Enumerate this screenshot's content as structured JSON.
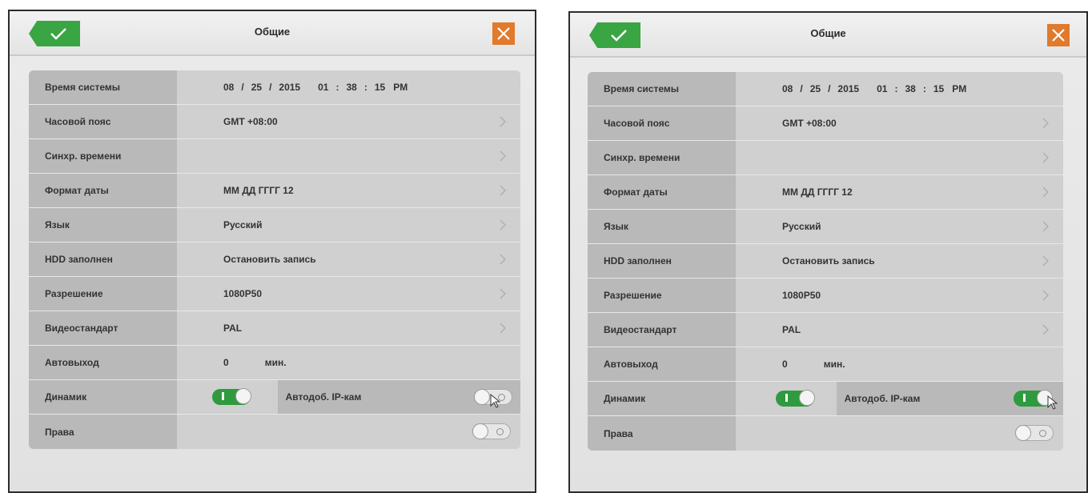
{
  "panels": [
    {
      "title": "Общие",
      "rows": {
        "time": {
          "label": "Время системы",
          "month": "08",
          "day": "25",
          "year": "2015",
          "hour": "01",
          "minute": "38",
          "second": "15",
          "ampm": "PM"
        },
        "tz": {
          "label": "Часовой пояс",
          "value": "GMT  +08:00"
        },
        "sync": {
          "label": "Синхр. времени",
          "value": ""
        },
        "datefmt": {
          "label": "Формат даты",
          "value": "ММ ДД ГГГГ 12"
        },
        "lang": {
          "label": "Язык",
          "value": "Русский"
        },
        "hdd": {
          "label": "HDD заполнен",
          "value": "Остановить запись"
        },
        "res": {
          "label": "Разрешение",
          "value": "1080P50"
        },
        "video": {
          "label": "Видеостандарт",
          "value": "PAL"
        },
        "auto": {
          "label": "Автовыход",
          "value": "0",
          "unit": "мин."
        },
        "speaker": {
          "label": "Динамик",
          "state": "on"
        },
        "ipcam": {
          "label": "Автодоб. IP-кам",
          "state": "off"
        },
        "rights": {
          "label": "Права",
          "state": "off"
        }
      }
    },
    {
      "title": "Общие",
      "rows": {
        "time": {
          "label": "Время системы",
          "month": "08",
          "day": "25",
          "year": "2015",
          "hour": "01",
          "minute": "38",
          "second": "15",
          "ampm": "PM"
        },
        "tz": {
          "label": "Часовой пояс",
          "value": "GMT  +08:00"
        },
        "sync": {
          "label": "Синхр. времени",
          "value": ""
        },
        "datefmt": {
          "label": "Формат даты",
          "value": "ММ ДД ГГГГ 12"
        },
        "lang": {
          "label": "Язык",
          "value": "Русский"
        },
        "hdd": {
          "label": "HDD заполнен",
          "value": "Остановить запись"
        },
        "res": {
          "label": "Разрешение",
          "value": "1080P50"
        },
        "video": {
          "label": "Видеостандарт",
          "value": "PAL"
        },
        "auto": {
          "label": "Автовыход",
          "value": "0",
          "unit": "мин."
        },
        "speaker": {
          "label": "Динамик",
          "state": "on"
        },
        "ipcam": {
          "label": "Автодоб. IP-кам",
          "state": "on"
        },
        "rights": {
          "label": "Права",
          "state": "off"
        }
      }
    }
  ],
  "colors": {
    "confirm": "#3aa543",
    "close": "#e07a2c",
    "toggle_on": "#2f9a3e"
  },
  "icons": {
    "confirm": "checkmark-icon",
    "close": "close-icon",
    "chevron": "chevron-right-icon",
    "cursor": "mouse-pointer-icon"
  }
}
